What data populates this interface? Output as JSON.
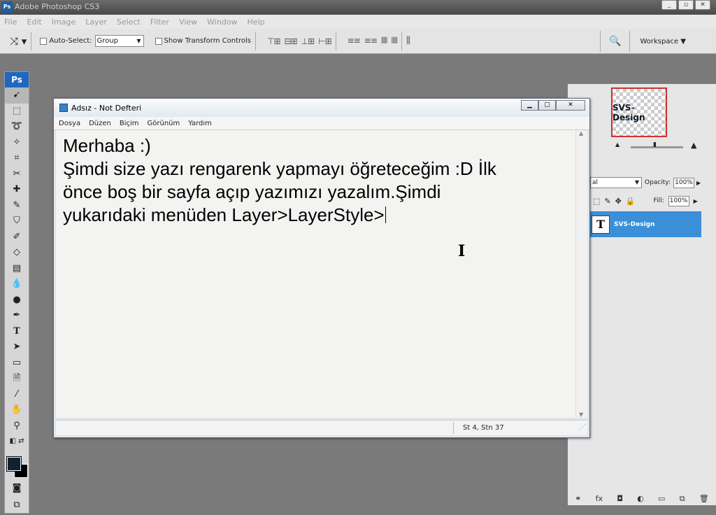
{
  "photoshop": {
    "app_title": "Adobe Photoshop CS3",
    "badge": "Ps",
    "menu": [
      "File",
      "Edit",
      "Image",
      "Layer",
      "Select",
      "Filter",
      "View",
      "Window",
      "Help"
    ],
    "options": {
      "auto_select_label": "Auto-Select:",
      "auto_select_value": "Group",
      "show_transform_label": "Show Transform Controls"
    },
    "workspace_label": "Workspace ▼",
    "toolbox_badge": "Ps",
    "navigator_thumb_text": "SVS-Design",
    "layers": {
      "blend_mode": "al",
      "opacity_label": "Opacity:",
      "opacity_value": "100%",
      "fill_label": "Fill:",
      "fill_value": "100%",
      "layer_name": "SVS-Design",
      "layer_thumb": "T"
    }
  },
  "notepad": {
    "title": "Adsız - Not Defteri",
    "menu": [
      "Dosya",
      "Düzen",
      "Biçim",
      "Görünüm",
      "Yardım"
    ],
    "lines": [
      "Merhaba :)",
      "Şimdi size yazı rengarenk yapmayı öğreteceğim :D İlk",
      "önce boş bir sayfa açıp yazımızı yazalım.Şimdi",
      "yukarıdaki menüden Layer>LayerStyle>"
    ],
    "status": "St 4, Stn 37"
  }
}
